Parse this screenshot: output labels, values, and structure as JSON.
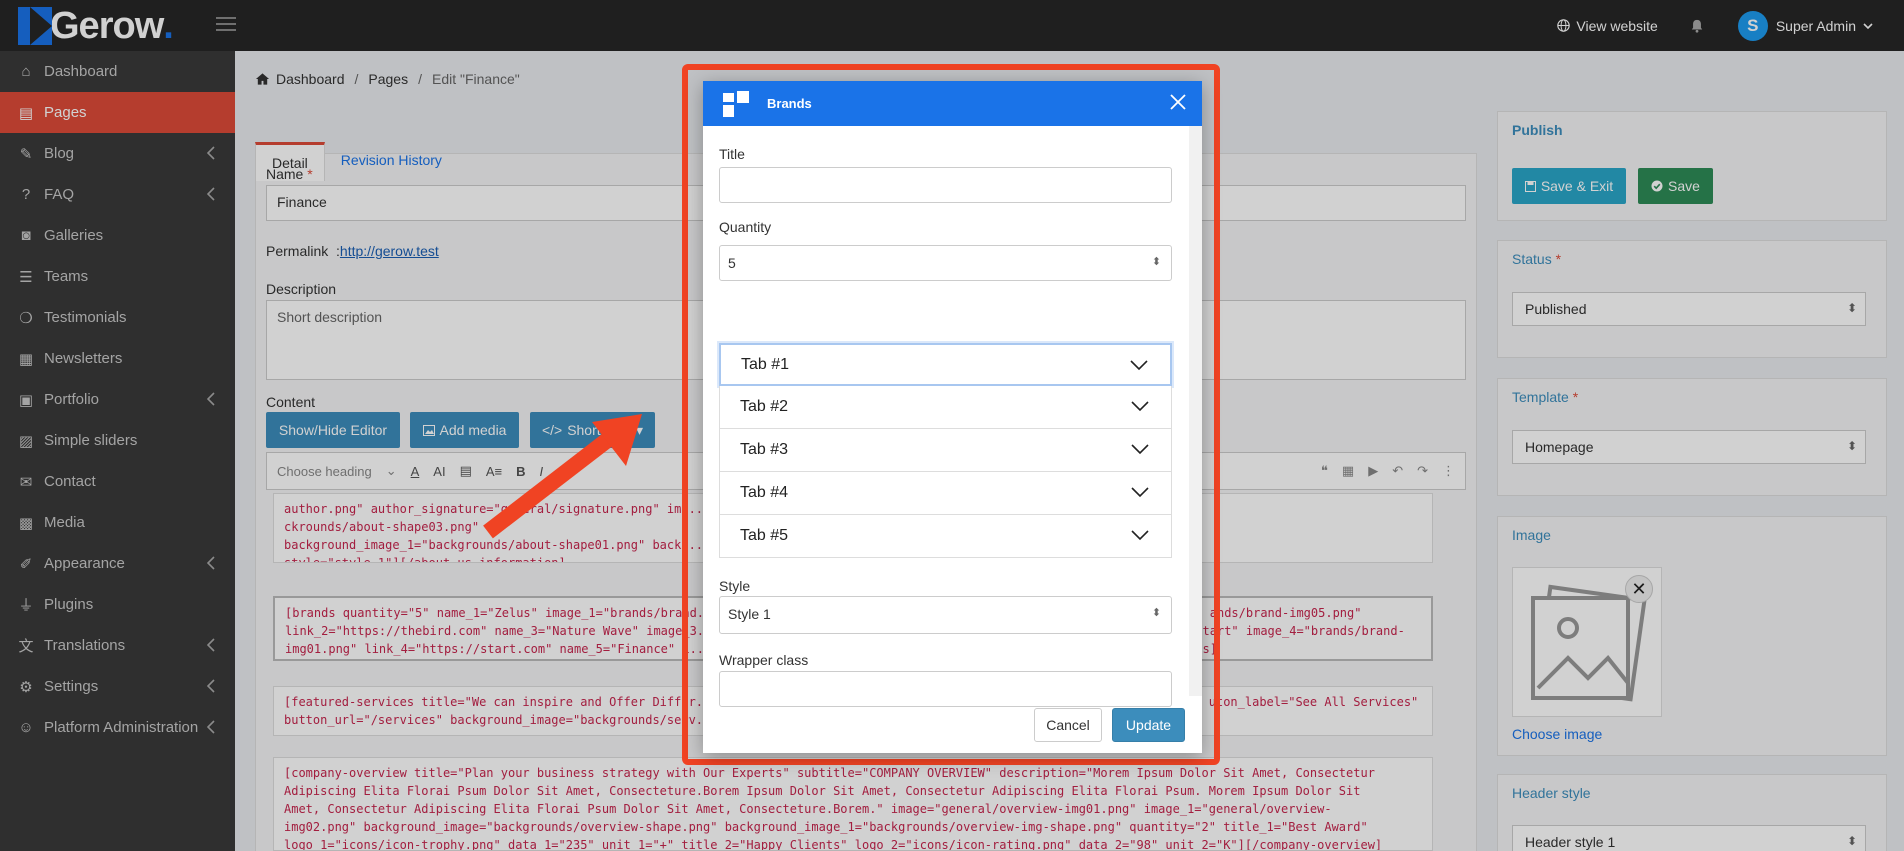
{
  "topbar": {
    "logo_text": "Gerow",
    "logo_dot": ".",
    "view_website": "View website",
    "user_initial": "S",
    "user_name": "Super Admin"
  },
  "sidebar": {
    "items": [
      {
        "label": "Dashboard",
        "icon": "home-icon",
        "chevron": false
      },
      {
        "label": "Pages",
        "icon": "page-icon",
        "chevron": false,
        "active": true
      },
      {
        "label": "Blog",
        "icon": "edit-icon",
        "chevron": true
      },
      {
        "label": "FAQ",
        "icon": "question-icon",
        "chevron": true
      },
      {
        "label": "Galleries",
        "icon": "camera-icon",
        "chevron": false
      },
      {
        "label": "Teams",
        "icon": "list-icon",
        "chevron": false
      },
      {
        "label": "Testimonials",
        "icon": "comment-icon",
        "chevron": false
      },
      {
        "label": "Newsletters",
        "icon": "newspaper-icon",
        "chevron": false
      },
      {
        "label": "Portfolio",
        "icon": "briefcase-icon",
        "chevron": true
      },
      {
        "label": "Simple sliders",
        "icon": "image-icon",
        "chevron": false
      },
      {
        "label": "Contact",
        "icon": "envelope-icon",
        "chevron": false
      },
      {
        "label": "Media",
        "icon": "photo-icon",
        "chevron": false
      },
      {
        "label": "Appearance",
        "icon": "brush-icon",
        "chevron": true
      },
      {
        "label": "Plugins",
        "icon": "plug-icon",
        "chevron": false
      },
      {
        "label": "Translations",
        "icon": "language-icon",
        "chevron": true
      },
      {
        "label": "Settings",
        "icon": "cogs-icon",
        "chevron": true
      },
      {
        "label": "Platform Administration",
        "icon": "user-shield-icon",
        "chevron": true
      }
    ]
  },
  "breadcrumb": {
    "home": "Dashboard",
    "sep1": "/",
    "pages": "Pages",
    "sep2": "/",
    "current": "Edit \"Finance\""
  },
  "editor": {
    "tab_detail": "Detail",
    "tab_revision": "Revision History",
    "name_label": "Name",
    "required_mark": "*",
    "name_value": "Finance",
    "permalink_label": "Permalink",
    "permalink_colon": ":",
    "permalink_url": "http://gerow.test",
    "description_label": "Description",
    "description_placeholder": "Short description",
    "content_label": "Content",
    "btn_show_hide": "Show/Hide Editor",
    "btn_add_media": "Add media",
    "btn_shortcode": "Shortcode",
    "heading_select": "Choose heading",
    "code_1": "author.png\" author_signature=\"general/signature.png\" ima...                                                                                                              ckrounds/about-shape03.png\"\nbackground_image_1=\"backgrounds/about-shape01.png\" backg...\nstyle=\"style-1\"][/about-us-information]",
    "code_2": "[brands quantity=\"5\" name_1=\"Zelus\" image_1=\"brands/brand...                                                                    ands/brand-img05.png\"\nlink_2=\"https://thebird.com\" name_3=\"Nature Wave\" image_3...                                                                   tart\" image_4=\"brands/brand-\nimg01.png\" link_4=\"https://start.com\" name_5=\"Finance\" i...                                                                    s]",
    "code_3": "[featured-services title=\"We can inspire and Offer Differ...                                                                    uton_label=\"See All Services\"\nbutton_url=\"/services\" background_image=\"backgrounds/serv...",
    "code_4": "[company-overview title=\"Plan your business strategy with Our Experts\" subtitle=\"COMPANY OVERVIEW\" description=\"Morem Ipsum Dolor Sit Amet, Consectetur\nAdipiscing Elita Florai Psum Dolor Sit Amet, Consecteture.Borem Ipsum Dolor Sit Amet, Consectetur Adipiscing Elita Florai Psum. Morem Ipsum Dolor Sit\nAmet, Consectetur Adipiscing Elita Florai Psum Dolor Sit Amet, Consecteture.Borem.\" image=\"general/overview-img01.png\" image_1=\"general/overview-\nimg02.png\" background_image=\"backgrounds/overview-shape.png\" background_image_1=\"backgrounds/overview-img-shape.png\" quantity=\"2\" title_1=\"Best Award\"\nlogo_1=\"icons/icon-trophy.png\" data_1=\"235\" unit_1=\"+\" title_2=\"Happy Clients\" logo_2=\"icons/icon-rating.png\" data_2=\"98\" unit_2=\"K\"][/company-overview]"
  },
  "publish": {
    "title": "Publish",
    "save_exit": "Save & Exit",
    "save": "Save",
    "status_label": "Status",
    "status_value": "Published",
    "template_label": "Template",
    "template_value": "Homepage",
    "image_label": "Image",
    "choose_image": "Choose image",
    "header_style_label": "Header style",
    "header_style_value": "Header style 1"
  },
  "modal": {
    "title": "Brands",
    "title_label": "Title",
    "title_value": "",
    "quantity_label": "Quantity",
    "quantity_value": "5",
    "tabs": [
      "Tab #1",
      "Tab #2",
      "Tab #3",
      "Tab #4",
      "Tab #5"
    ],
    "style_label": "Style",
    "style_value": "Style 1",
    "wrapper_label": "Wrapper class",
    "wrapper_value": "",
    "cancel": "Cancel",
    "update": "Update"
  },
  "colors": {
    "accent_blue": "#1a73e8",
    "active_red": "#dd4b39",
    "highlight_red": "#f04323",
    "save_green": "#2e8b57",
    "save_exit_teal": "#2aa7c9"
  }
}
